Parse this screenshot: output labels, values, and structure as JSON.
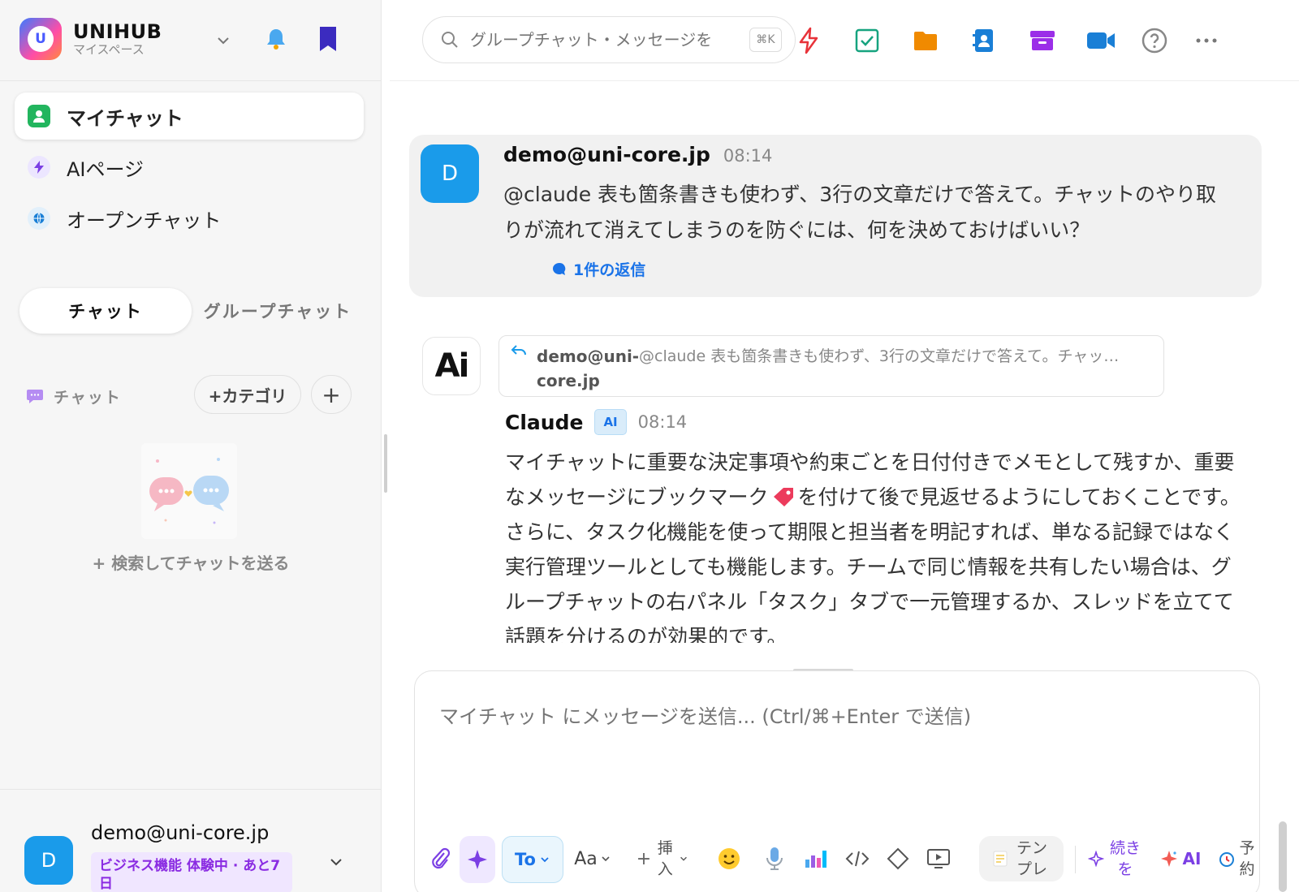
{
  "brand": {
    "name": "UNIHUB",
    "sub": "マイスペース",
    "logo_letter": "U"
  },
  "sidebar": {
    "nav": [
      {
        "label": "マイチャット",
        "icon": "person-icon",
        "active": true
      },
      {
        "label": "AIページ",
        "icon": "lightning-icon"
      },
      {
        "label": "オープンチャット",
        "icon": "globe-icon"
      }
    ],
    "tabs": {
      "chat": "チャット",
      "group_chat": "グループチャット"
    },
    "category": {
      "label": "チャット",
      "add_category": "+カテゴリ",
      "add": "+"
    },
    "empty_text": "+ 検索してチャットを送る",
    "user": {
      "avatar": "D",
      "email": "demo@uni-core.jp",
      "badge": "ビジネス機能 体験中 · あと7日"
    }
  },
  "search": {
    "placeholder": "グループチャット・メッセージを",
    "shortcut": "⌘K"
  },
  "messages": {
    "first": {
      "avatar": "D",
      "author": "demo@uni-core.jp",
      "time": "08:14",
      "text": "@claude 表も箇条書きも使わず、3行の文章だけで答えて。チャットのやり取りが流れて消えてしまうのを防ぐには、何を決めておけばいい？",
      "reply_count": "1件の返信"
    },
    "second": {
      "avatar": "Ai",
      "quote_author": "demo@uni-core.jp",
      "quote_text": "@claude 表も箇条書きも使わず、3行の文章だけで答えて。チャッ…",
      "author": "Claude",
      "badge": "AI",
      "time": "08:14",
      "text_part1": "マイチャットに重要な決定事項や約束ごとを日付付きでメモとして残すか、重要なメッセージにブックマーク",
      "text_part2": "を付けて後で見返せるようにしておくことです。さらに、タスク化機能を使って期限と担当者を明記すれば、単なる記録ではなく実行管理ツールとしても機能します。チームで同じ情報を共有したい場合は、グループチャットの右パネル「タスク」タブで一元管理するか、スレッドを立てて話題を分けるのが効果的です。"
    }
  },
  "composer": {
    "placeholder": "マイチャット にメッセージを送信... (Ctrl/⌘+Enter で送信)",
    "to": "To",
    "font": "Aa",
    "insert_plus": "+",
    "insert": "挿入",
    "template": "テンプレ",
    "continue": "続きを",
    "ai": "AI",
    "schedule": "予約"
  },
  "colors": {
    "accent_blue": "#1a9bea",
    "ai_purple": "#8a2be2"
  }
}
